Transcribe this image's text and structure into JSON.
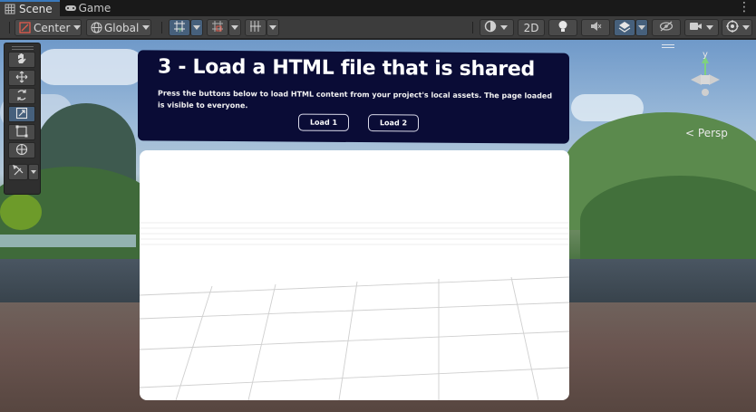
{
  "tabs": [
    {
      "label": "Scene",
      "active": true
    },
    {
      "label": "Game",
      "active": false
    }
  ],
  "toolbar": {
    "pivot_label": "Center",
    "space_label": "Global",
    "mode_2d": "2D"
  },
  "gizmo": {
    "axis_label": "y",
    "projection_label": "Persp"
  },
  "scene_panel": {
    "title": "3 - Load a HTML file that is shared",
    "description": "Press the buttons below to load HTML content from your project's local assets. The page loaded is visible to everyone.",
    "buttons": [
      "Load 1",
      "Load 2"
    ]
  },
  "colors": {
    "accent": "#3a79bb",
    "panel_bg": "#0a0c36",
    "selected_tool": "#46607c"
  }
}
